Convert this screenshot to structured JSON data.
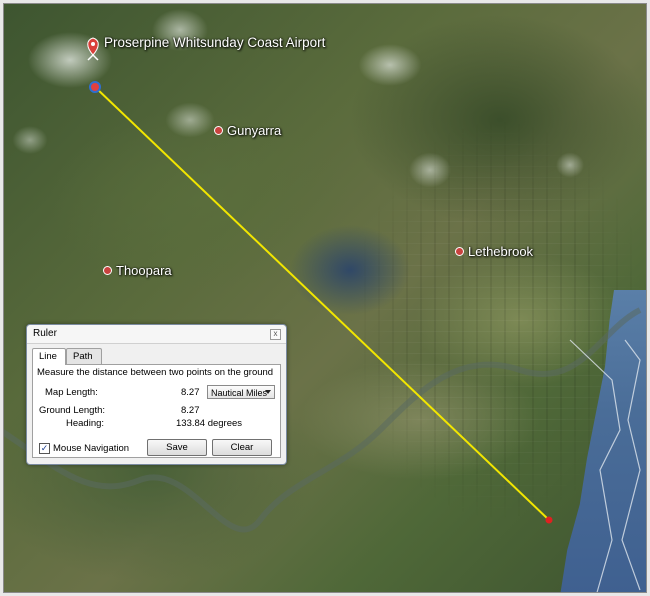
{
  "map": {
    "airport": {
      "label": "Proserpine Whitsunday Coast Airport",
      "pin_color": "#d9403a"
    },
    "places": [
      {
        "label": "Gunyarra"
      },
      {
        "label": "Lethebrook"
      },
      {
        "label": "Thoopara"
      }
    ],
    "measure_line_color": "#f2e600",
    "endpoint_color": "#e02020"
  },
  "ruler": {
    "title": "Ruler",
    "close_glyph": "x",
    "tabs": [
      {
        "label": "Line",
        "active": true
      },
      {
        "label": "Path",
        "active": false
      }
    ],
    "instruction": "Measure the distance between two points on the ground",
    "map_length": {
      "label": "Map Length:",
      "value": "8.27",
      "unit": "Nautical Miles"
    },
    "ground_length": {
      "label": "Ground Length:",
      "value": "8.27"
    },
    "heading": {
      "label": "Heading:",
      "value": "133.84 degrees"
    },
    "mouse_navigation": {
      "label": "Mouse Navigation",
      "checked": true,
      "check_glyph": "✓"
    },
    "buttons": {
      "save": "Save",
      "clear": "Clear"
    }
  }
}
